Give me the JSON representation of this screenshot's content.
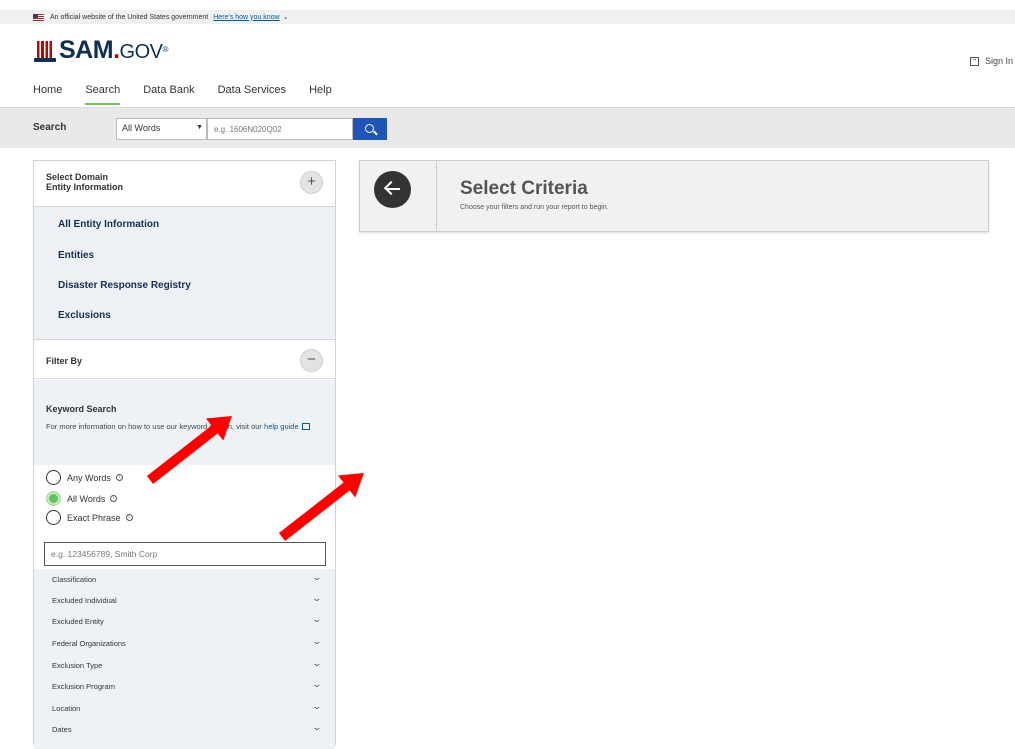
{
  "banner": {
    "text": "An official website of the United States government",
    "link": "Here's how you know",
    "chevron": "⌄"
  },
  "logo": {
    "main": "SAM",
    "dot": ".",
    "gov": "GOV",
    "reg": "®"
  },
  "header": {
    "sign_in": "Sign In"
  },
  "nav": {
    "items": [
      "Home",
      "Search",
      "Data Bank",
      "Data Services",
      "Help"
    ],
    "active": "Search"
  },
  "search": {
    "label": "Search",
    "select_value": "All Words",
    "placeholder": "e.g. 1606N020Q02"
  },
  "domain": {
    "label": "Select Domain",
    "value": "Entity Information",
    "expand": "+",
    "items": [
      "All Entity Information",
      "Entities",
      "Disaster Response Registry",
      "Exclusions"
    ]
  },
  "filter": {
    "title": "Filter By",
    "collapse": "−",
    "keyword_title": "Keyword Search",
    "help_text": "For more information on how to use our keyword search, visit our",
    "help_link": "help guide",
    "radios": [
      {
        "label": "Any Words",
        "checked": false
      },
      {
        "label": "All Words",
        "checked": true
      },
      {
        "label": "Exact Phrase",
        "checked": false
      }
    ],
    "info_glyph": "i",
    "keyword_placeholder": "e.g. 123456789, Smith Corp",
    "sections": [
      "Classification",
      "Excluded Individual",
      "Excluded Entity",
      "Federal Organizations",
      "Exclusion Type",
      "Exclusion Program",
      "Location",
      "Dates"
    ],
    "section_chevron": "⌄"
  },
  "criteria": {
    "title": "Select Criteria",
    "subtitle": "Choose your filters and run your report to begin."
  },
  "colors": {
    "accent_green": "#72c45c",
    "search_button": "#1f56b5",
    "annotation_arrow": "#ff0000",
    "navy": "#112e51"
  }
}
